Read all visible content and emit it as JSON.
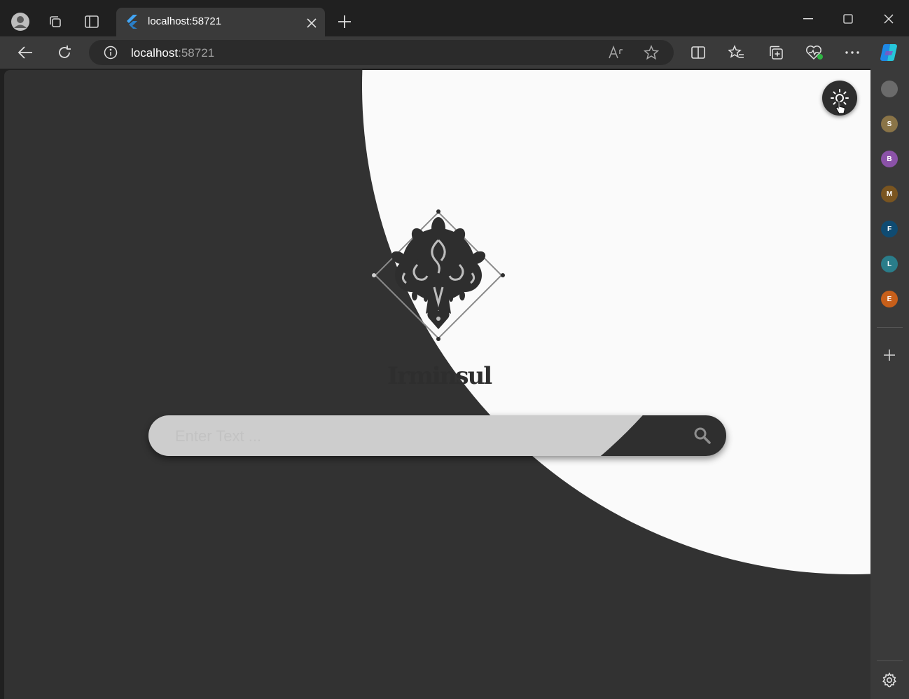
{
  "browser": {
    "tab": {
      "title": "localhost:58721"
    },
    "address_bar": {
      "host": "localhost",
      "port": ":58721"
    },
    "icons": [
      "profile-icon",
      "workspaces-icon",
      "vertical-tabs-icon",
      "flutter-favicon",
      "close-tab-icon",
      "new-tab-icon",
      "minimize-icon",
      "maximize-icon",
      "close-window-icon",
      "back-icon",
      "refresh-icon",
      "site-info-icon",
      "read-aloud-icon",
      "favorite-star-icon",
      "split-screen-icon",
      "favorites-icon",
      "collections-icon",
      "browser-essentials-icon",
      "more-icon",
      "copilot-icon"
    ]
  },
  "sidebar": {
    "items": [
      {
        "letter": "",
        "color": "#6b6b6b"
      },
      {
        "letter": "S",
        "color": "#8a7447"
      },
      {
        "letter": "B",
        "color": "#8b52a8"
      },
      {
        "letter": "M",
        "color": "#7a5520"
      },
      {
        "letter": "F",
        "color": "#0f4b72"
      },
      {
        "letter": "L",
        "color": "#2a7d8a"
      },
      {
        "letter": "E",
        "color": "#c75f1a"
      }
    ]
  },
  "page": {
    "brand": "Irminsul",
    "search": {
      "placeholder": "Enter Text ..."
    },
    "colors": {
      "dark_bg": "#323232",
      "light_bg": "#fafafa",
      "search_dark": "#2f2f2f",
      "search_light": "#cdcdcd"
    }
  }
}
